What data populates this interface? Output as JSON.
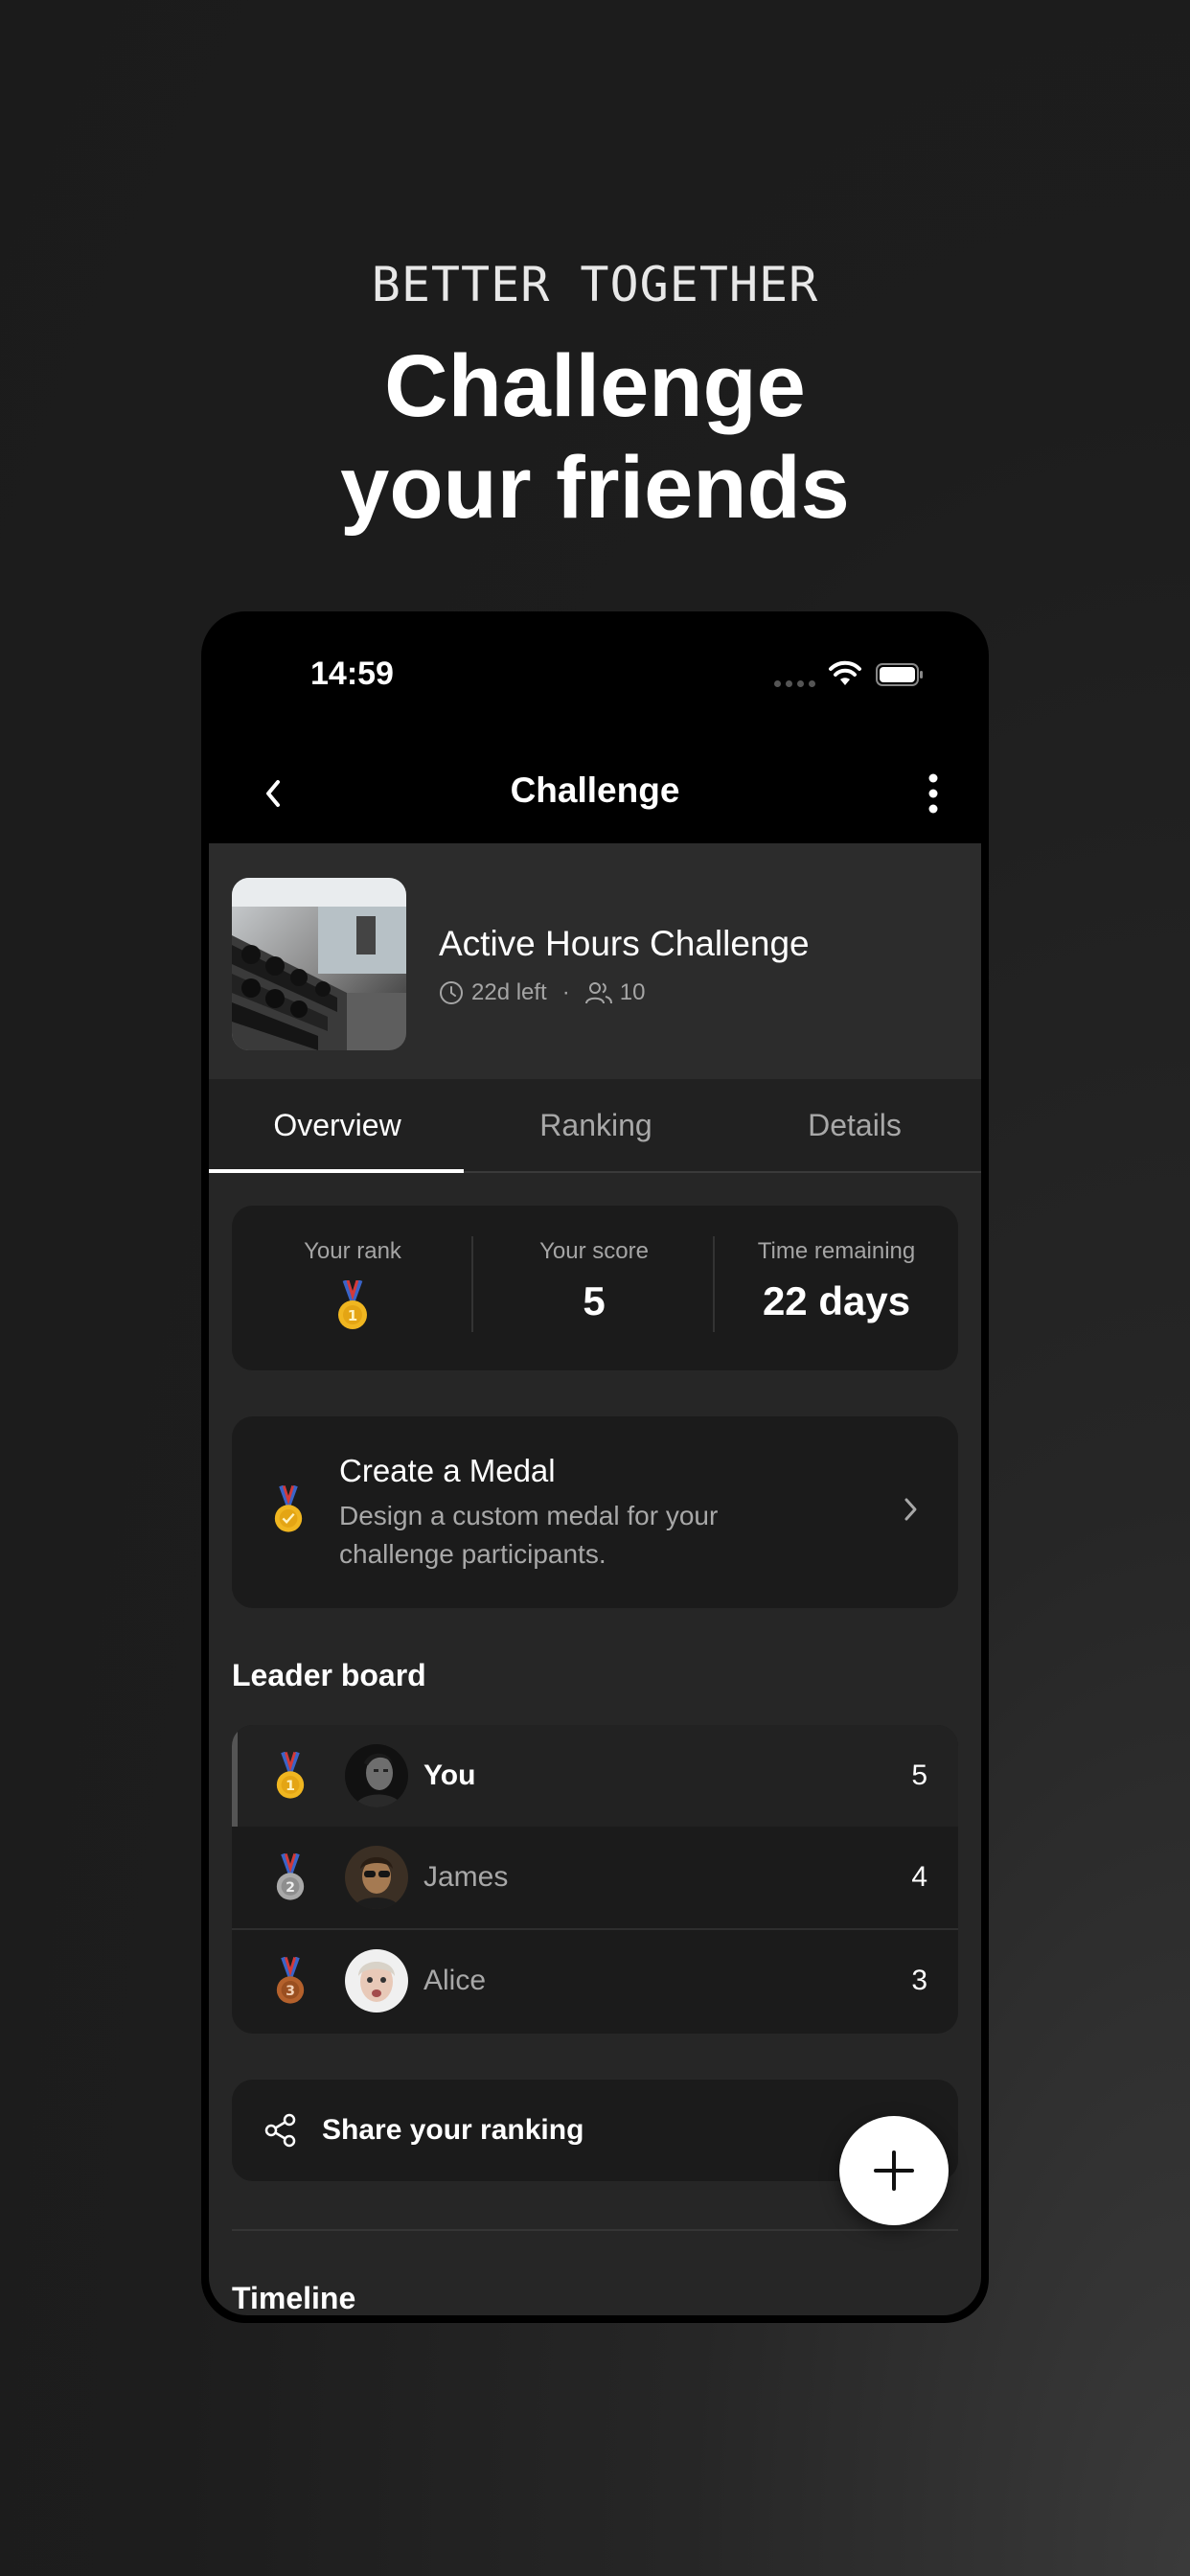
{
  "promo": {
    "kicker": "BETTER TOGETHER",
    "headline_line1": "Challenge",
    "headline_line2": "your friends"
  },
  "statusbar": {
    "time": "14:59"
  },
  "navbar": {
    "title": "Challenge"
  },
  "challenge": {
    "title": "Active Hours Challenge",
    "time_left": "22d left",
    "separator": "·",
    "participants": "10"
  },
  "tabs": [
    {
      "label": "Overview",
      "active": true
    },
    {
      "label": "Ranking",
      "active": false
    },
    {
      "label": "Details",
      "active": false
    }
  ],
  "stats": {
    "rank_label": "Your rank",
    "score_label": "Your score",
    "score_value": "5",
    "time_label": "Time remaining",
    "time_value": "22 days"
  },
  "medal_card": {
    "title": "Create a Medal",
    "description": "Design a custom medal for your challenge participants."
  },
  "leaderboard": {
    "title": "Leader board",
    "rows": [
      {
        "rank": "1",
        "name": "You",
        "score": "5"
      },
      {
        "rank": "2",
        "name": "James",
        "score": "4"
      },
      {
        "rank": "3",
        "name": "Alice",
        "score": "3"
      }
    ]
  },
  "share": {
    "label": "Share your ranking"
  },
  "timeline": {
    "title": "Timeline"
  },
  "colors": {
    "gold": "#f0b620",
    "silver": "#a9a9a9",
    "bronze": "#b4612c",
    "ribbon_red": "#d33a3a",
    "ribbon_blue": "#3a64c8"
  },
  "icons": [
    "back-icon",
    "more-icon",
    "clock-icon",
    "people-icon",
    "medal-icon",
    "chevron-right-icon",
    "share-icon",
    "plus-icon",
    "wifi-icon",
    "battery-icon"
  ]
}
